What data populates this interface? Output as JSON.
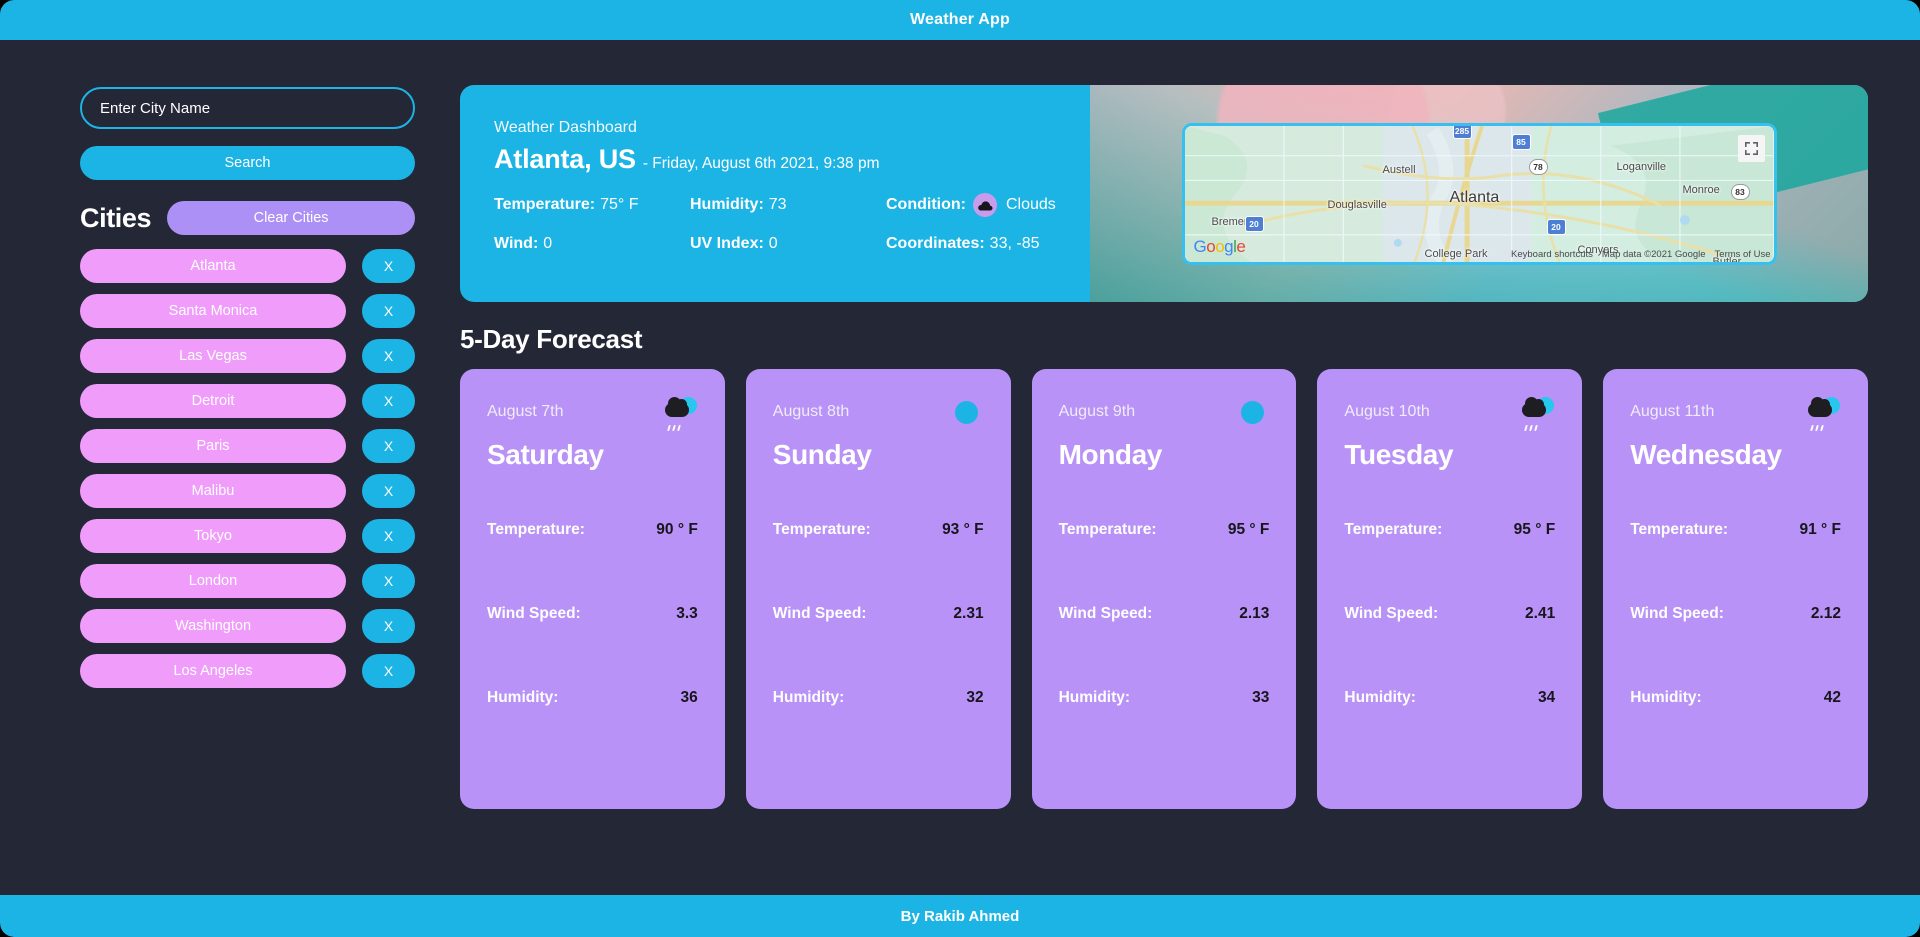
{
  "header": {
    "title": "Weather App"
  },
  "footer": {
    "text": "By Rakib Ahmed"
  },
  "colors": {
    "accent_cyan": "#1cb4e4",
    "background_dark": "#242736",
    "chip_pink": "#f09cfa",
    "chip_purple": "#ad90f5",
    "card_purple": "#b892f7"
  },
  "sidebar": {
    "search_input": {
      "placeholder": "Enter City Name",
      "value": ""
    },
    "search_button": "Search",
    "cities_heading": "Cities",
    "clear_button": "Clear Cities",
    "remove_label": "X",
    "cities": [
      "Atlanta",
      "Santa Monica",
      "Las Vegas",
      "Detroit",
      "Paris",
      "Malibu",
      "Tokyo",
      "London",
      "Washington",
      "Los Angeles"
    ]
  },
  "dashboard": {
    "subtitle": "Weather Dashboard",
    "city": "Atlanta, US",
    "date": "- Friday, August 6th 2021, 9:38 pm",
    "stats": {
      "temperature_label": "Temperature:",
      "temperature_value": "75° F",
      "humidity_label": "Humidity:",
      "humidity_value": "73",
      "condition_label": "Condition:",
      "condition_value": "Clouds",
      "condition_icon": "cloud-icon",
      "wind_label": "Wind:",
      "wind_value": "0",
      "uv_label": "UV Index:",
      "uv_value": "0",
      "coordinates_label": "Coordinates:",
      "coordinates_value": "33, -85"
    }
  },
  "map": {
    "center_label": "Atlanta",
    "labels": [
      "Austell",
      "Douglasville",
      "Bremen",
      "College Park",
      "Loganville",
      "Monroe",
      "Conyers",
      "Butler"
    ],
    "shields": [
      "285",
      "85",
      "78",
      "20",
      "20",
      "83"
    ],
    "google_logo": [
      "G",
      "o",
      "o",
      "g",
      "l",
      "e"
    ],
    "keyboard_shortcuts": "Keyboard shortcuts",
    "map_data": "Map data ©2021 Google",
    "terms": "Terms of Use",
    "fullscreen_icon": "fullscreen-icon"
  },
  "forecast": {
    "title": "5-Day Forecast",
    "labels": {
      "temperature": "Temperature:",
      "wind_speed": "Wind Speed:",
      "humidity": "Humidity:"
    },
    "days": [
      {
        "date": "August 7th",
        "day": "Saturday",
        "icon": "rain-cloud-icon",
        "temperature": "90 ° F",
        "wind_speed": "3.3",
        "humidity": "36"
      },
      {
        "date": "August 8th",
        "day": "Sunday",
        "icon": "clear-sky-icon",
        "temperature": "93 ° F",
        "wind_speed": "2.31",
        "humidity": "32"
      },
      {
        "date": "August 9th",
        "day": "Monday",
        "icon": "clear-sky-icon",
        "temperature": "95 ° F",
        "wind_speed": "2.13",
        "humidity": "33"
      },
      {
        "date": "August 10th",
        "day": "Tuesday",
        "icon": "rain-cloud-icon",
        "temperature": "95 ° F",
        "wind_speed": "2.41",
        "humidity": "34"
      },
      {
        "date": "August 11th",
        "day": "Wednesday",
        "icon": "rain-cloud-icon",
        "temperature": "91 ° F",
        "wind_speed": "2.12",
        "humidity": "42"
      }
    ]
  }
}
